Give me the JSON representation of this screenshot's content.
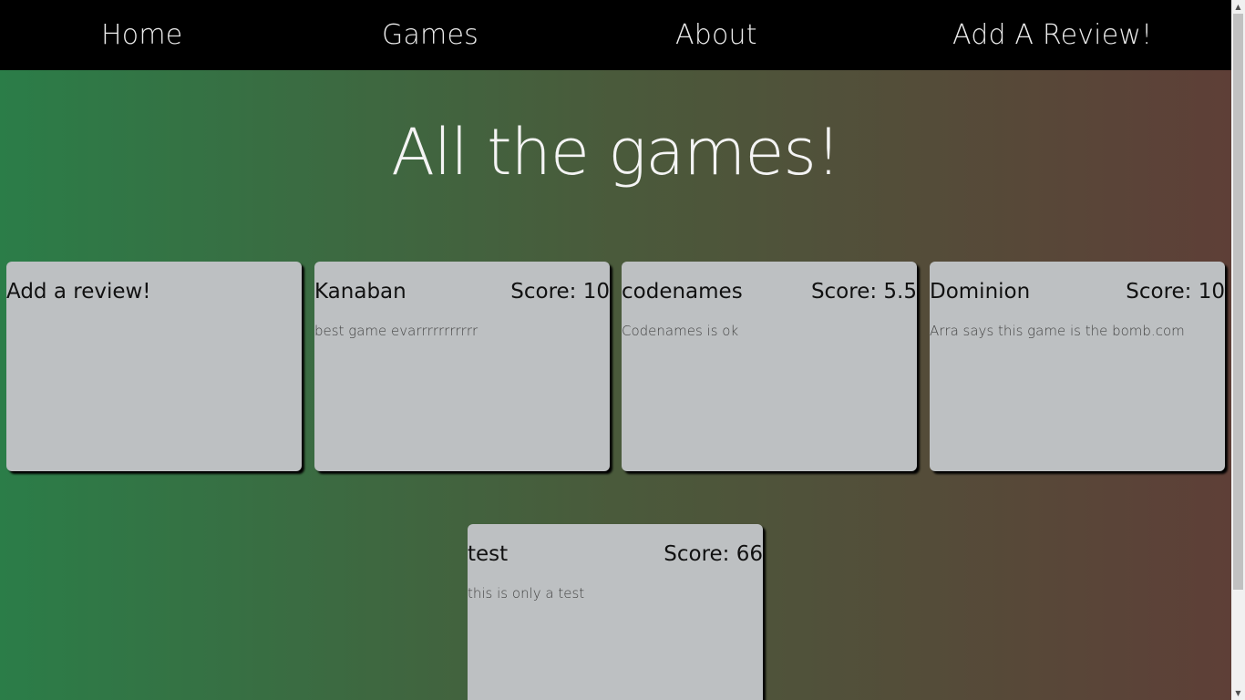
{
  "nav": {
    "items": [
      {
        "label": "Home"
      },
      {
        "label": "Games"
      },
      {
        "label": "About"
      },
      {
        "label": "Add A Review!"
      }
    ]
  },
  "main": {
    "title": "All the games!"
  },
  "add_card": {
    "label": "Add a review!"
  },
  "reviews": [
    {
      "name": "Kanaban",
      "score": "Score: 10",
      "text": "best game evarrrrrrrrrrr"
    },
    {
      "name": "codenames",
      "score": "Score: 5.5",
      "text": "Codenames is ok"
    },
    {
      "name": "Dominion",
      "score": "Score: 10",
      "text": "Arra says this game is the bomb.com"
    },
    {
      "name": "test",
      "score": "Score: 66",
      "text": "this is only a test"
    }
  ],
  "colors": {
    "gradient_left": "#2b7d48",
    "gradient_mid": "#4a5a3b",
    "gradient_right": "#5e3f37",
    "card_bg": "#bdc0c2",
    "navbar_bg": "#000000"
  }
}
